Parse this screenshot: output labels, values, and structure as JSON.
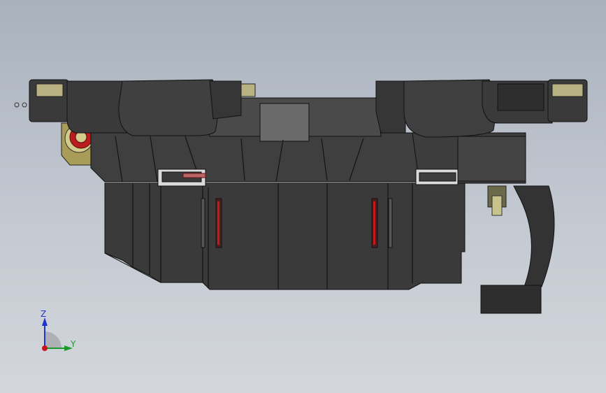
{
  "viewport": {
    "background_top": "#a9b1bd",
    "background_bottom": "#d3d6dc"
  },
  "model": {
    "body_color": "#3b3b3b",
    "edge_color": "#111111",
    "accent_red": "#c11a1a",
    "accent_yellow": "#c8c48a"
  },
  "triad": {
    "z_label": "Z",
    "y_label": "Y",
    "z_color": "#1f35c8",
    "y_color": "#1c9a2a",
    "x_color": "#c8141e"
  }
}
